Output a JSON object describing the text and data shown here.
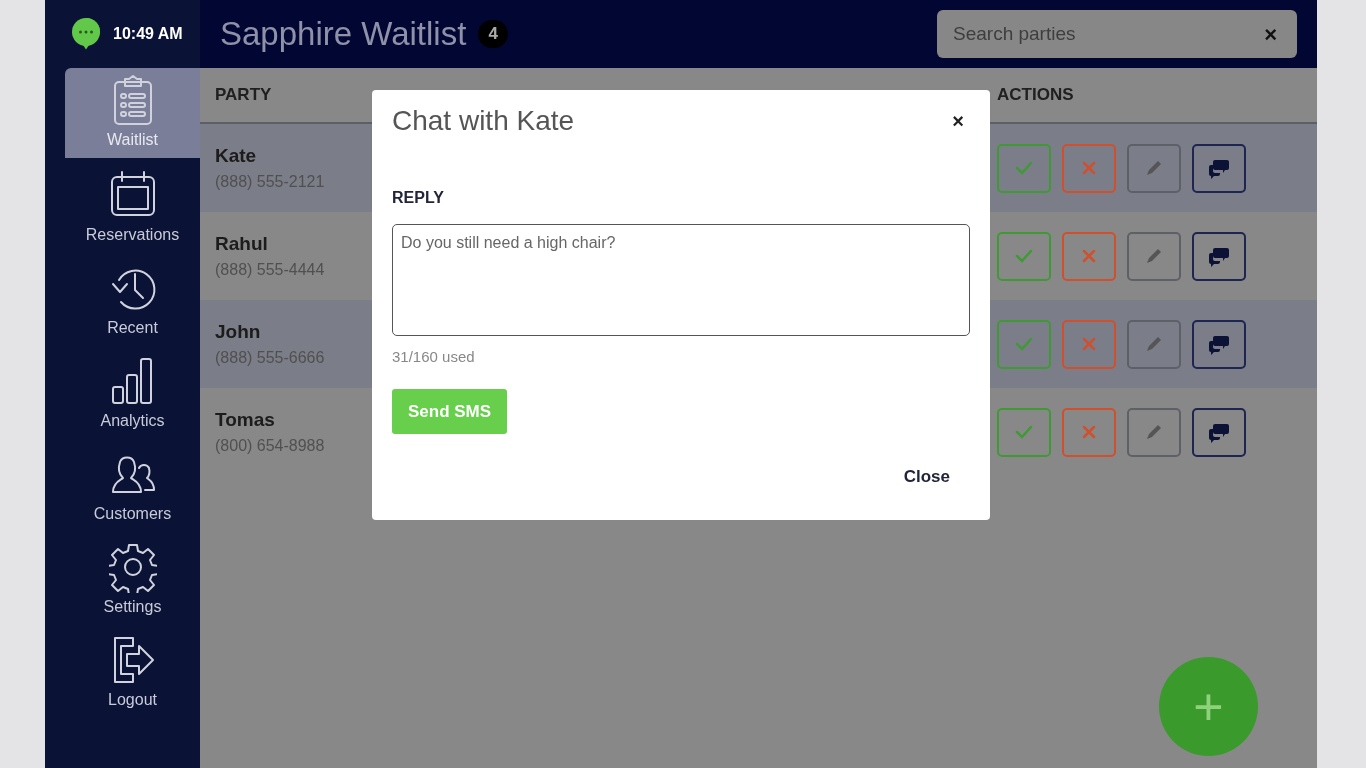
{
  "status": {
    "time": "10:49 AM"
  },
  "header": {
    "title": "Sapphire Waitlist",
    "count": "4"
  },
  "search": {
    "placeholder": "Search parties",
    "clear": "×"
  },
  "sidebar": {
    "items": [
      {
        "label": "Waitlist",
        "selected": true
      },
      {
        "label": "Reservations",
        "selected": false
      },
      {
        "label": "Recent",
        "selected": false
      },
      {
        "label": "Analytics",
        "selected": false
      },
      {
        "label": "Customers",
        "selected": false
      },
      {
        "label": "Settings",
        "selected": false
      },
      {
        "label": "Logout",
        "selected": false
      }
    ]
  },
  "table": {
    "columns": [
      "PARTY",
      "ACTIONS"
    ],
    "rows": [
      {
        "name": "Kate",
        "phone": "(888) 555-2121"
      },
      {
        "name": "Rahul",
        "phone": "(888) 555-4444"
      },
      {
        "name": "John",
        "phone": "(888) 555-6666"
      },
      {
        "name": "Tomas",
        "phone": "(800) 654-8988"
      }
    ]
  },
  "dialog": {
    "title": "Chat with Kate",
    "close_icon": "×",
    "label": "REPLY",
    "message": "Do you still need a high chair?",
    "counter": "31/160 used",
    "send": "Send SMS",
    "close": "Close"
  },
  "fab": "+"
}
